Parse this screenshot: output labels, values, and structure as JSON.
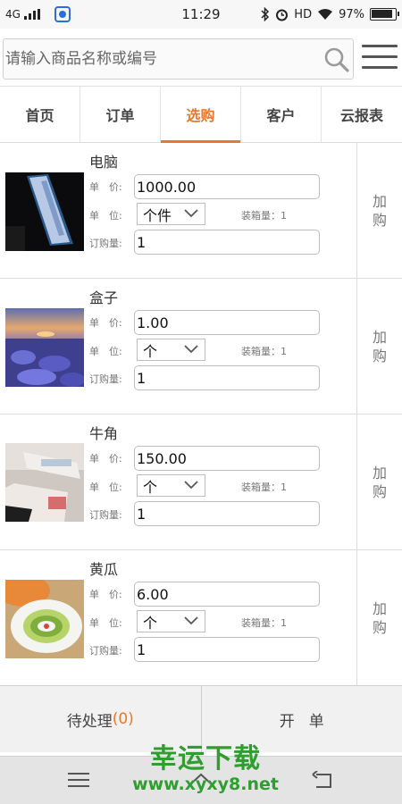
{
  "status_bar": {
    "network": "4G",
    "time": "11:29",
    "hd": "HD",
    "battery": "97%"
  },
  "search": {
    "placeholder": "请输入商品名称或编号"
  },
  "tabs": [
    {
      "label": "首页"
    },
    {
      "label": "订单"
    },
    {
      "label": "选购",
      "active": true
    },
    {
      "label": "客户"
    },
    {
      "label": "云报表"
    }
  ],
  "labels": {
    "price": "单　价:",
    "unit": "单　位:",
    "qty": "订购量:",
    "buy": "加购"
  },
  "products": [
    {
      "name": "电脑",
      "price": "1000.00",
      "unit": "个件",
      "pack": "装箱量：1",
      "qty": "1"
    },
    {
      "name": "盒子",
      "price": "1.00",
      "unit": "个",
      "pack": "装箱量：1",
      "qty": "1"
    },
    {
      "name": "牛角",
      "price": "150.00",
      "unit": "个",
      "pack": "装箱量：1",
      "qty": "1"
    },
    {
      "name": "黄瓜",
      "price": "6.00",
      "unit": "个",
      "pack": "装箱量：1",
      "qty": "1"
    }
  ],
  "actions": {
    "pending_label": "待处理",
    "pending_count": "(0)",
    "open_label": "开单"
  },
  "watermark": {
    "title": "幸运下载",
    "url": "www.xyxy8.net"
  },
  "colors": {
    "accent": "#e8782a",
    "watermark": "#2e9e2e"
  }
}
